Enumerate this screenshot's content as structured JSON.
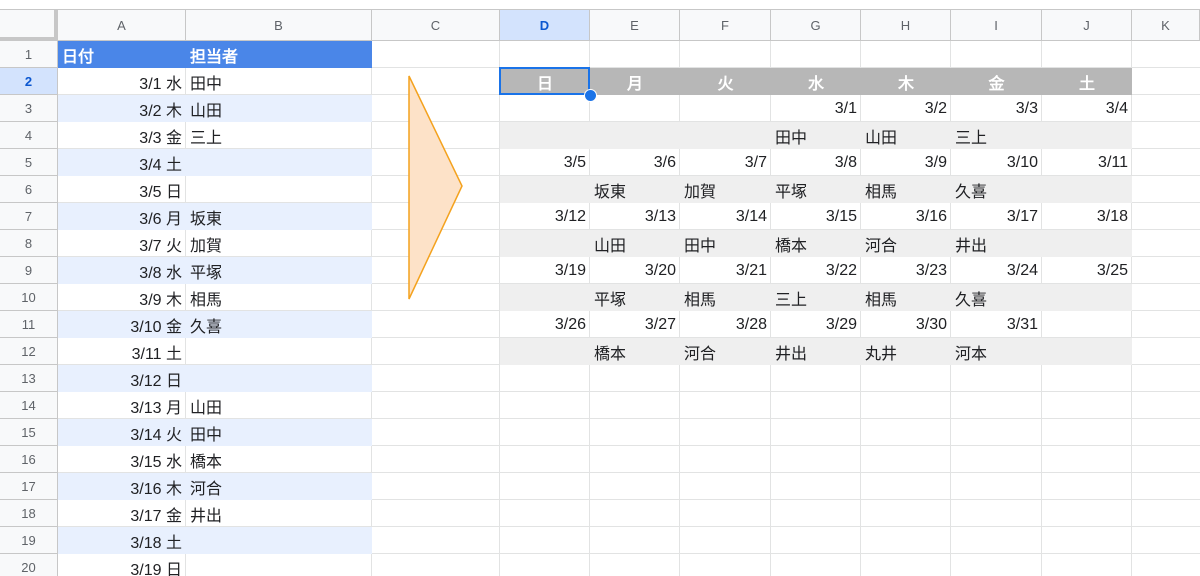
{
  "columns": [
    "A",
    "B",
    "C",
    "D",
    "E",
    "F",
    "G",
    "H",
    "I",
    "J",
    "K"
  ],
  "selected_column": "D",
  "rows": [
    "1",
    "2",
    "3",
    "4",
    "5",
    "6",
    "7",
    "8",
    "9",
    "10",
    "11",
    "12",
    "13",
    "14",
    "15",
    "16",
    "17",
    "18",
    "19",
    "20"
  ],
  "selected_row": "2",
  "list": {
    "header": {
      "date": "日付",
      "person": "担当者"
    },
    "entries": [
      {
        "date": "3/1 水",
        "person": "田中"
      },
      {
        "date": "3/2 木",
        "person": "山田"
      },
      {
        "date": "3/3 金",
        "person": "三上"
      },
      {
        "date": "3/4 土",
        "person": ""
      },
      {
        "date": "3/5 日",
        "person": ""
      },
      {
        "date": "3/6 月",
        "person": "坂東"
      },
      {
        "date": "3/7 火",
        "person": "加賀"
      },
      {
        "date": "3/8 水",
        "person": "平塚"
      },
      {
        "date": "3/9 木",
        "person": "相馬"
      },
      {
        "date": "3/10 金",
        "person": "久喜"
      },
      {
        "date": "3/11 土",
        "person": ""
      },
      {
        "date": "3/12 日",
        "person": ""
      },
      {
        "date": "3/13 月",
        "person": "山田"
      },
      {
        "date": "3/14 火",
        "person": "田中"
      },
      {
        "date": "3/15 水",
        "person": "橋本"
      },
      {
        "date": "3/16 木",
        "person": "河合"
      },
      {
        "date": "3/17 金",
        "person": "井出"
      },
      {
        "date": "3/18 土",
        "person": ""
      },
      {
        "date": "3/19 日",
        "person": ""
      }
    ]
  },
  "calendar": {
    "weekdays": [
      "日",
      "月",
      "火",
      "水",
      "木",
      "金",
      "土"
    ],
    "weeks": [
      {
        "dates": [
          "",
          "",
          "",
          "3/1",
          "3/2",
          "3/3",
          "3/4"
        ],
        "persons": [
          "",
          "",
          "",
          "田中",
          "山田",
          "三上",
          ""
        ]
      },
      {
        "dates": [
          "3/5",
          "3/6",
          "3/7",
          "3/8",
          "3/9",
          "3/10",
          "3/11"
        ],
        "persons": [
          "",
          "坂東",
          "加賀",
          "平塚",
          "相馬",
          "久喜",
          ""
        ]
      },
      {
        "dates": [
          "3/12",
          "3/13",
          "3/14",
          "3/15",
          "3/16",
          "3/17",
          "3/18"
        ],
        "persons": [
          "",
          "山田",
          "田中",
          "橋本",
          "河合",
          "井出",
          ""
        ]
      },
      {
        "dates": [
          "3/19",
          "3/20",
          "3/21",
          "3/22",
          "3/23",
          "3/24",
          "3/25"
        ],
        "persons": [
          "",
          "平塚",
          "相馬",
          "三上",
          "相馬",
          "久喜",
          ""
        ]
      },
      {
        "dates": [
          "3/26",
          "3/27",
          "3/28",
          "3/29",
          "3/30",
          "3/31",
          ""
        ],
        "persons": [
          "",
          "橋本",
          "河合",
          "井出",
          "丸井",
          "河本",
          ""
        ]
      }
    ]
  },
  "colors": {
    "list_header_bg": "#4a86e8",
    "list_band_bg": "#e8f0fe",
    "calendar_header_bg": "#b7b7b7",
    "calendar_band_bg": "#efefef",
    "selection": "#1a73e8",
    "arrow_fill": "#fde2c8",
    "arrow_stroke": "#f4a21e"
  },
  "icons": {
    "arrow": "right-triangle-arrow-shape"
  }
}
